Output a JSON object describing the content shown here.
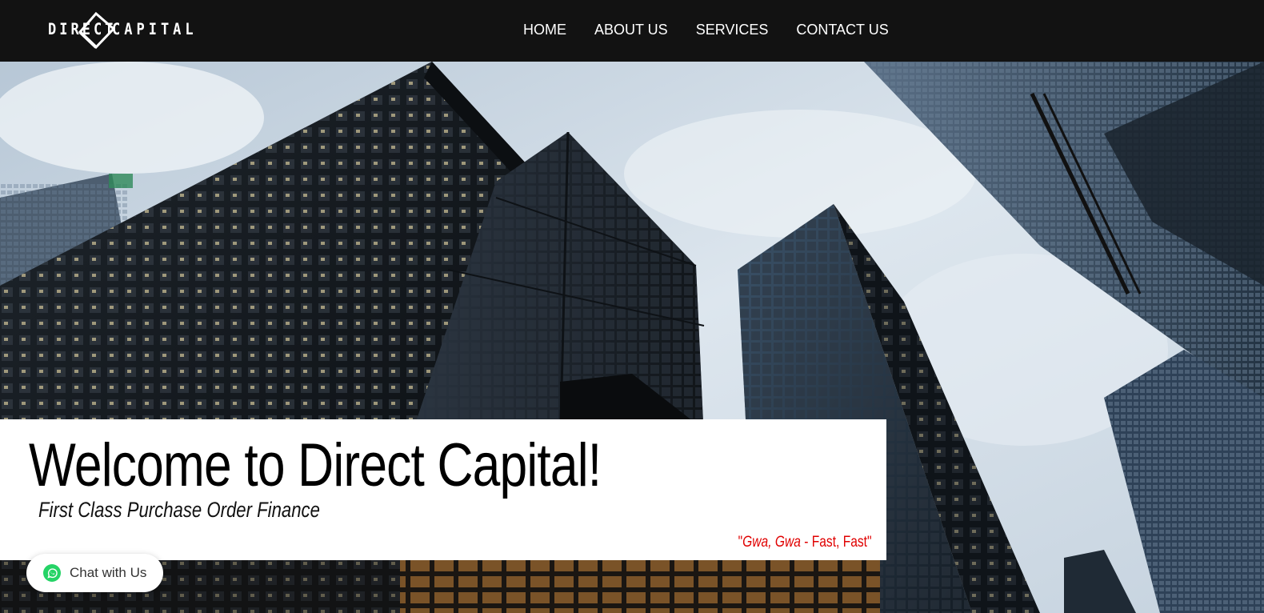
{
  "brand": {
    "word1": "DIRECT",
    "word2": "CAPITAL"
  },
  "nav": {
    "items": [
      {
        "label": "HOME"
      },
      {
        "label": "ABOUT US"
      },
      {
        "label": "SERVICES"
      },
      {
        "label": "CONTACT US"
      }
    ]
  },
  "hero": {
    "title": "Welcome to Direct Capital!",
    "subtitle": "First Class Purchase Order Finance",
    "slogan": {
      "open_quote": "\"",
      "italic": "Gwa, Gwa",
      "rest": " - Fast, Fast\""
    }
  },
  "chat": {
    "label": "Chat with Us",
    "icon": "whatsapp-icon",
    "color": "#25d366"
  },
  "colors": {
    "navbar": "#121212",
    "slogan": "#e00000",
    "card": "#ffffff"
  }
}
